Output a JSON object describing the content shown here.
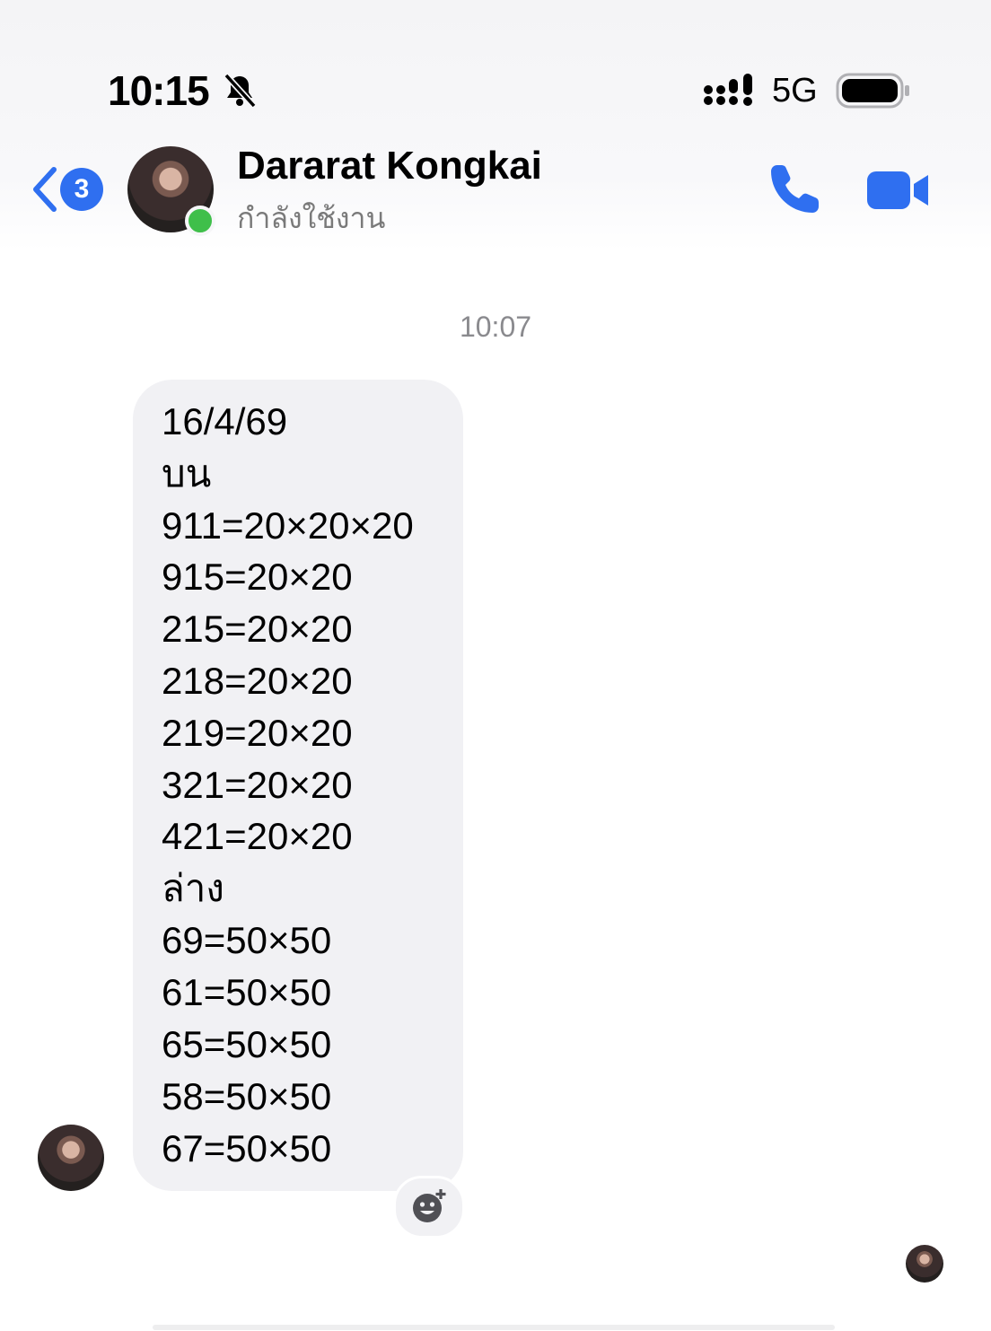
{
  "status_bar": {
    "time": "10:15",
    "network": "5G",
    "icons": [
      "bell-slash-icon",
      "signal-icon",
      "battery-icon"
    ]
  },
  "header": {
    "back_badge_count": "3",
    "contact_name": "Dararat Kongkai",
    "contact_status": "กำลังใช้งาน",
    "icons": [
      "back-chevron-icon",
      "phone-icon",
      "video-camera-icon"
    ],
    "accent_color": "#2f6ff0",
    "online_color": "#3fbf4a"
  },
  "conversation": {
    "timestamp": "10:07",
    "message_lines": [
      "16/4/69",
      "บน",
      "911=20×20×20",
      "915=20×20",
      "215=20×20",
      "218=20×20",
      "219=20×20",
      "321=20×20",
      "421=20×20",
      "ล่าง",
      "69=50×50",
      "61=50×50",
      "65=50×50",
      "58=50×50",
      "67=50×50"
    ],
    "bubble_color": "#f1f1f4",
    "reaction_icon": "add-reaction-icon"
  }
}
